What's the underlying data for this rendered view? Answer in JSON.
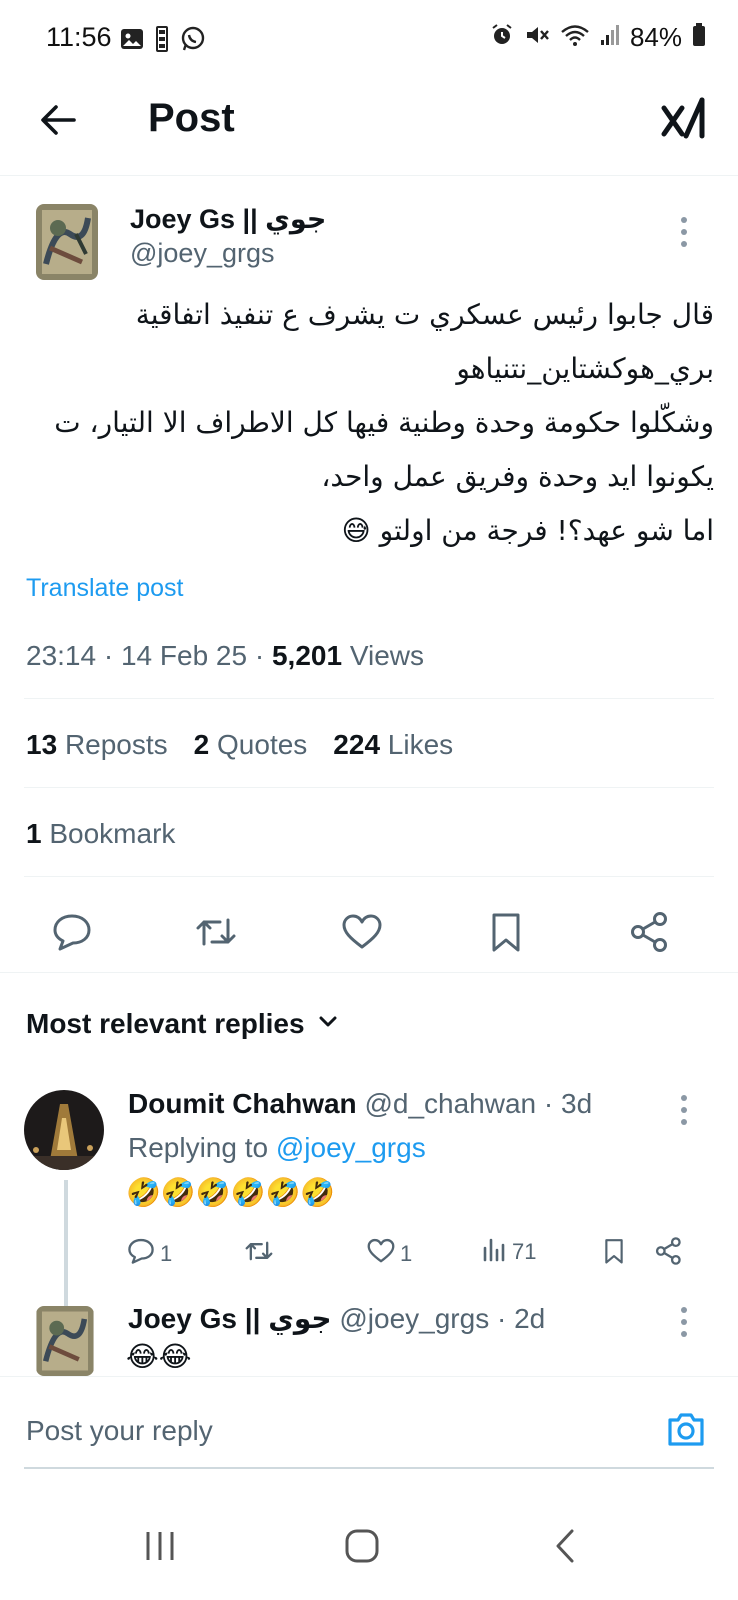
{
  "status_bar": {
    "time": "11:56",
    "battery": "84%",
    "left_icons": [
      "gallery-icon",
      "lbci-app-icon",
      "whatsapp-icon"
    ],
    "right_icons": [
      "alarm-icon",
      "mute-icon",
      "wifi-icon",
      "signal-icon",
      "battery-icon"
    ]
  },
  "header": {
    "title": "Post"
  },
  "post": {
    "author_name": "Joey Gs || جوي",
    "author_handle": "@joey_grgs",
    "text": "قال جابوا رئيس عسكري ت يشرف ع تنفيذ اتفاقية بري_هوكشتاين_نتنياهو\nوشكّلوا حكومة وحدة وطنية فيها كل الاطراف الا التيار، ت يكونوا ايد وحدة وفريق عمل واحد،\nاما شو عهد؟! فرجة من اولتو",
    "emoji": "😅",
    "translate_label": "Translate post",
    "time": "23:14",
    "date": "14 Feb 25",
    "views_count": "5,201",
    "views_label": "Views",
    "reposts_count": "13",
    "reposts_label": "Reposts",
    "quotes_count": "2",
    "quotes_label": "Quotes",
    "likes_count": "224",
    "likes_label": "Likes",
    "bookmarks_count": "1",
    "bookmarks_label": "Bookmark"
  },
  "replies": {
    "header_label": "Most relevant replies",
    "items": [
      {
        "name": "Doumit Chahwan",
        "handle": "@d_chahwan",
        "age": "3d",
        "replying_prefix": "Replying to",
        "replying_to": "@joey_grgs",
        "emojis": "🤣🤣🤣🤣🤣🤣",
        "reply_count": "1",
        "like_count": "1",
        "views_count": "71"
      },
      {
        "name": "Joey Gs || جوي",
        "handle": "@joey_grgs",
        "age": "2d",
        "emojis": "😂😂"
      }
    ]
  },
  "compose": {
    "placeholder": "Post your reply"
  },
  "colors": {
    "accent": "#1d9bf0",
    "secondary_text": "#536471",
    "primary_text": "#0f1419",
    "divider": "#eff3f4"
  }
}
